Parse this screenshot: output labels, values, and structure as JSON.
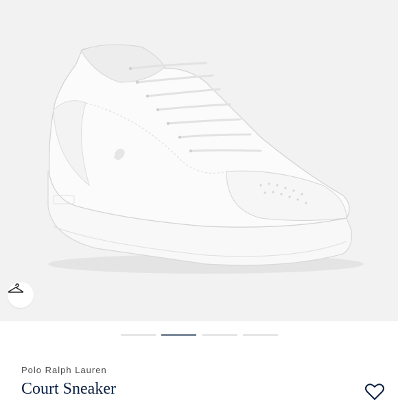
{
  "product": {
    "brand": "Polo Ralph Lauren",
    "name": "Court Sneaker"
  },
  "gallery": {
    "slide_count": 4,
    "active_index": 1,
    "image_subject": "white leather low-top sneaker"
  },
  "icons": {
    "hanger": "hanger-icon",
    "favorite": "heart-icon"
  },
  "colors": {
    "image_background": "#f2f2f2",
    "indicator_active": "#7c8a99",
    "indicator_inactive": "#e6e6e6",
    "title": "#0b1f3f"
  }
}
